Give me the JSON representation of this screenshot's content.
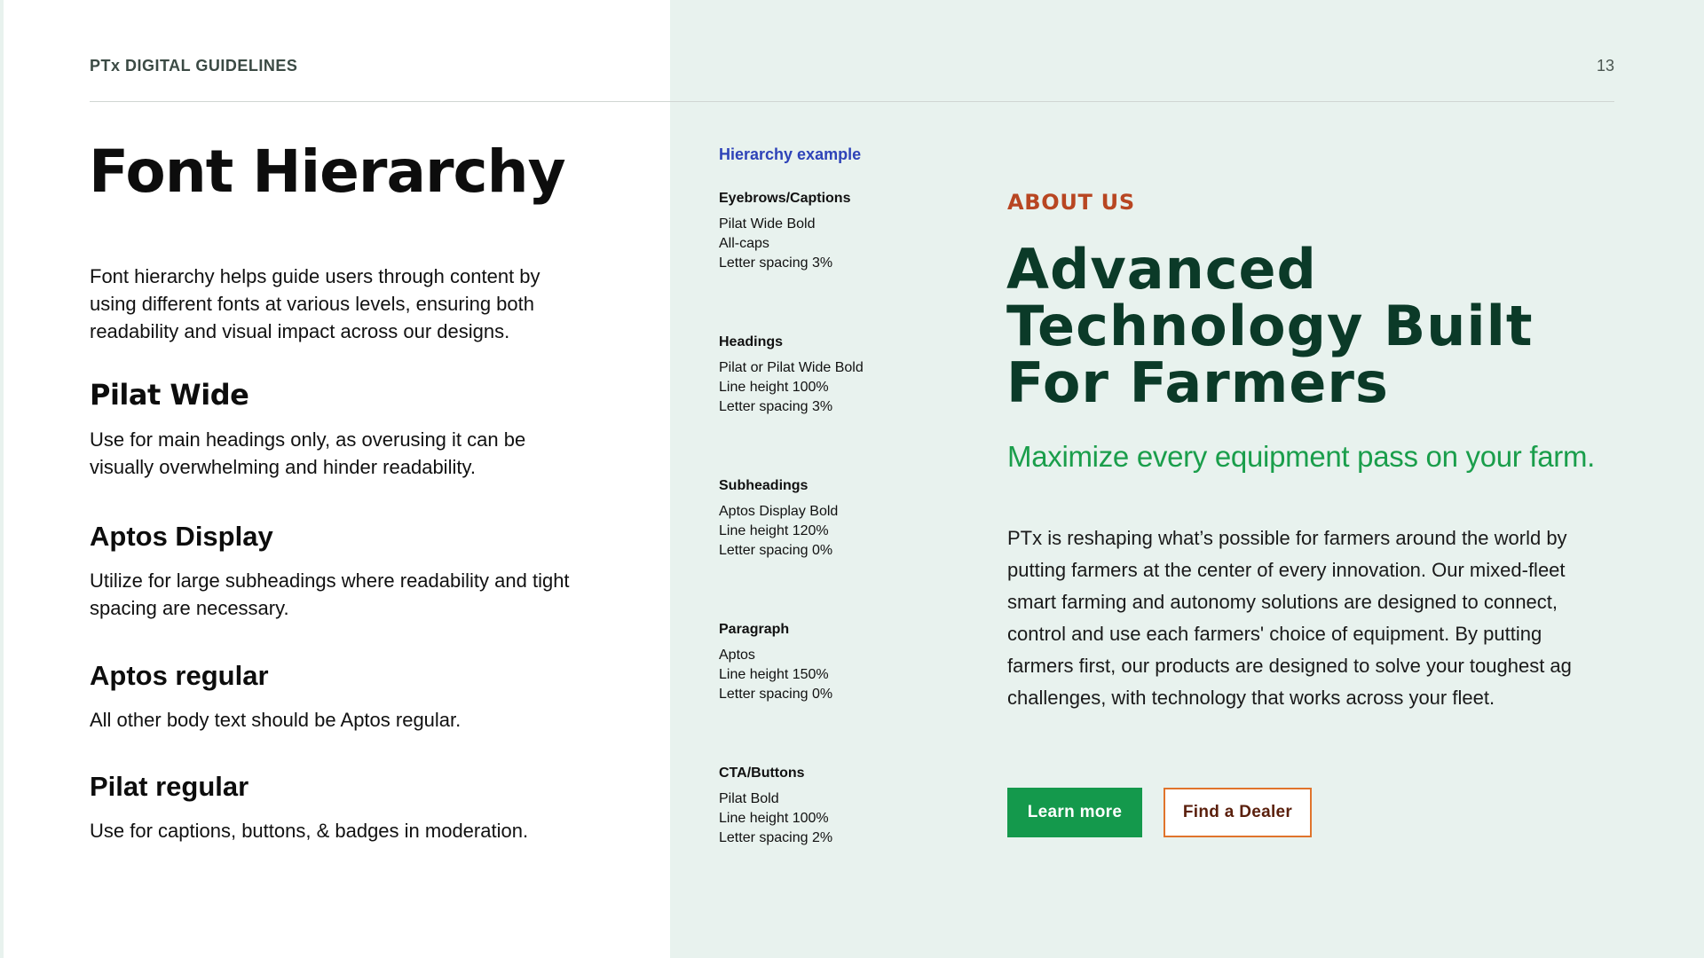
{
  "header": {
    "eyebrow": "PTx DIGITAL GUIDELINES",
    "page_number": "13"
  },
  "left": {
    "title": "Font Hierarchy",
    "intro": "Font hierarchy helps guide users through content by using different fonts at various levels, ensuring both readability and visual impact across our designs.",
    "fonts": [
      {
        "name": "Pilat Wide",
        "description": "Use for main headings only, as overusing it can be visually overwhelming and hinder readability."
      },
      {
        "name": "Aptos Display",
        "description": "Utilize for large subheadings where readability and tight spacing are necessary."
      },
      {
        "name": "Aptos regular",
        "description": "All other body text should be Aptos regular."
      },
      {
        "name": "Pilat regular",
        "description": "Use for captions, buttons, & badges in moderation."
      }
    ]
  },
  "hierarchy": {
    "title": "Hierarchy example",
    "specs": [
      {
        "label": "Eyebrows/Captions",
        "lines": [
          "Pilat Wide Bold",
          "All-caps",
          "Letter spacing 3%"
        ]
      },
      {
        "label": "Headings",
        "lines": [
          "Pilat or Pilat Wide Bold",
          "Line height 100%",
          "Letter spacing  3%"
        ]
      },
      {
        "label": "Subheadings",
        "lines": [
          "Aptos Display Bold",
          "Line height 120%",
          "Letter spacing  0%"
        ]
      },
      {
        "label": "Paragraph",
        "lines": [
          "Aptos",
          "Line height 150%",
          "Letter spacing  0%"
        ]
      },
      {
        "label": "CTA/Buttons",
        "lines": [
          "Pilat Bold",
          "Line height 100%",
          "Letter spacing 2%"
        ]
      }
    ]
  },
  "example": {
    "eyebrow": "ABOUT US",
    "heading_lines": [
      "Advanced",
      "Technology Built",
      "For Farmers"
    ],
    "subheading": "Maximize every equipment pass on your farm.",
    "paragraph": "PTx is reshaping what’s possible for farmers around the world by putting farmers at the center of every innovation. Our mixed-fleet smart farming and autonomy solutions are designed to connect, control and use each farmers' choice of equipment. By putting farmers first, our products are designed to solve your toughest ag challenges, with technology that works across your fleet.",
    "primary_button": "Learn more",
    "secondary_button": "Find a Dealer"
  },
  "colors": {
    "panel_bg": "#e8f2ee",
    "hierarchy_title": "#2e43b8",
    "eyebrow": "#b84622",
    "heading": "#0b3a28",
    "subheading": "#1a9e4b",
    "primary_button": "#14994c",
    "secondary_border": "#e0742c"
  }
}
